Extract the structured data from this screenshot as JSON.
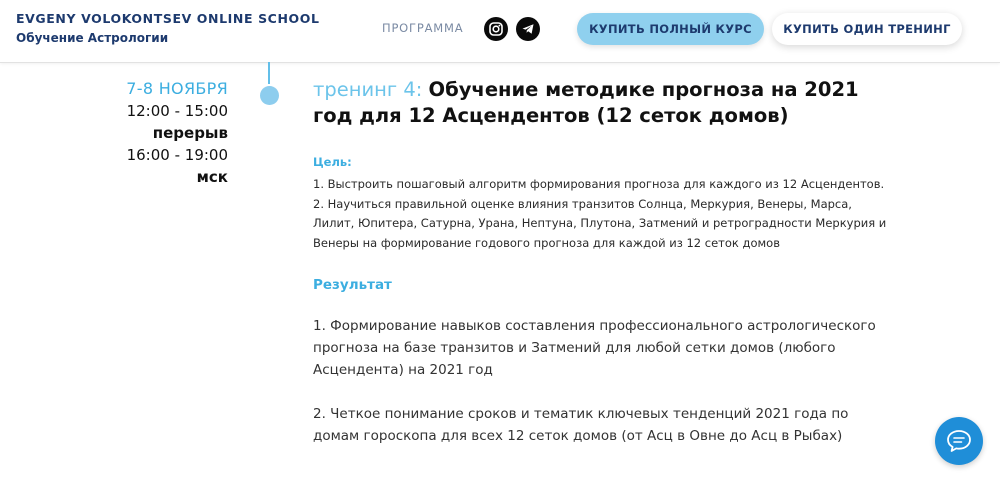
{
  "header": {
    "brand_name": "EVGENY VOLOKONTSEV ONLINE SCHOOL",
    "brand_sub": "Обучение Астрологии",
    "nav_program": "ПРОГРАММА",
    "social": [
      "instagram-icon",
      "telegram-icon"
    ],
    "buy_full": "КУПИТЬ ПОЛНЫЙ КУРС",
    "buy_one": "КУПИТЬ ОДИН ТРЕНИНГ"
  },
  "schedule": {
    "date": "7-8 НОЯБРЯ",
    "time1": "12:00 - 15:00",
    "break": "перерыв",
    "time2": "16:00 - 19:00",
    "tz": "мск"
  },
  "training": {
    "prefix": "тренинг 4: ",
    "title": "Обучение методике прогноза на 2021 год для 12 Асцендентов (12 сеток домов)",
    "goal_heading": "Цель:",
    "goals": [
      "1. Выстроить пошаговый алгоритм формирования прогноза для каждого из 12 Асцендентов.",
      "2. Научиться правильной оценке влияния транзитов Солнца, Меркурия, Венеры, Марса, Лилит, Юпитера, Сатурна, Урана, Нептуна, Плутона, Затмений и ретроградности Меркурия и Венеры на формирование годового прогноза для каждой из 12 сеток домов"
    ],
    "result_heading": "Результат",
    "results": [
      "1. Формирование навыков составления профессионального астрологического прогноза на базе транзитов и Затмений для любой сетки домов (любого Асцендента) на 2021 год",
      "2. Четкое понимание сроков и тематик ключевых тенденций 2021 года по домам гороскопа для всех 12 сеток домов (от Асц в Овне до Асц в Рыбах)"
    ]
  },
  "chat": {
    "icon": "chat-bubble-icon"
  },
  "colors": {
    "accent": "#3caee0",
    "brand": "#1d3a6e",
    "button_full": "#8fd0ee",
    "chat": "#1f8ed8"
  }
}
